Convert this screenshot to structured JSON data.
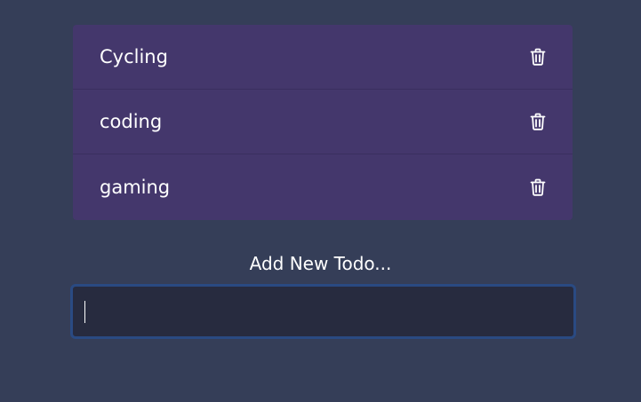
{
  "todos": [
    {
      "text": "Cycling",
      "delete_icon": "trash-icon"
    },
    {
      "text": "coding",
      "delete_icon": "trash-icon"
    },
    {
      "text": "gaming",
      "delete_icon": "trash-icon"
    }
  ],
  "add_form": {
    "label": "Add New Todo...",
    "input_value": "",
    "input_placeholder": ""
  },
  "colors": {
    "background": "#353e58",
    "list_background": "#44376c",
    "input_background": "#272b3f",
    "input_border": "#2a4a82",
    "text": "#ffffff"
  }
}
